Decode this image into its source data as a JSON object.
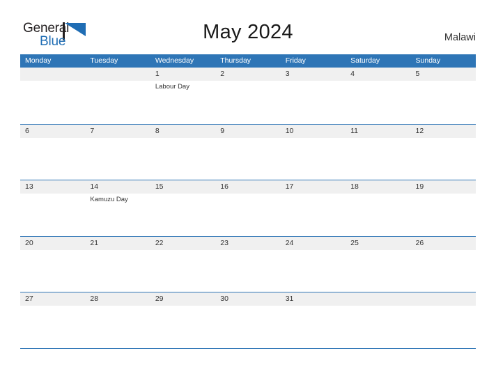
{
  "brand": {
    "name_part1": "General",
    "name_part2": "Blue",
    "mark_icon": "general-blue-triangle-logo",
    "accent_color": "#1f6db4"
  },
  "header": {
    "title": "May 2024",
    "country": "Malawi"
  },
  "calendar": {
    "header_bg_color": "#2e75b6",
    "band_bg_color": "#f0f0f0",
    "day_names": [
      "Monday",
      "Tuesday",
      "Wednesday",
      "Thursday",
      "Friday",
      "Saturday",
      "Sunday"
    ],
    "weeks": [
      [
        {
          "day": "",
          "event": ""
        },
        {
          "day": "",
          "event": ""
        },
        {
          "day": "1",
          "event": "Labour Day"
        },
        {
          "day": "2",
          "event": ""
        },
        {
          "day": "3",
          "event": ""
        },
        {
          "day": "4",
          "event": ""
        },
        {
          "day": "5",
          "event": ""
        }
      ],
      [
        {
          "day": "6",
          "event": ""
        },
        {
          "day": "7",
          "event": ""
        },
        {
          "day": "8",
          "event": ""
        },
        {
          "day": "9",
          "event": ""
        },
        {
          "day": "10",
          "event": ""
        },
        {
          "day": "11",
          "event": ""
        },
        {
          "day": "12",
          "event": ""
        }
      ],
      [
        {
          "day": "13",
          "event": ""
        },
        {
          "day": "14",
          "event": "Kamuzu Day"
        },
        {
          "day": "15",
          "event": ""
        },
        {
          "day": "16",
          "event": ""
        },
        {
          "day": "17",
          "event": ""
        },
        {
          "day": "18",
          "event": ""
        },
        {
          "day": "19",
          "event": ""
        }
      ],
      [
        {
          "day": "20",
          "event": ""
        },
        {
          "day": "21",
          "event": ""
        },
        {
          "day": "22",
          "event": ""
        },
        {
          "day": "23",
          "event": ""
        },
        {
          "day": "24",
          "event": ""
        },
        {
          "day": "25",
          "event": ""
        },
        {
          "day": "26",
          "event": ""
        }
      ],
      [
        {
          "day": "27",
          "event": ""
        },
        {
          "day": "28",
          "event": ""
        },
        {
          "day": "29",
          "event": ""
        },
        {
          "day": "30",
          "event": ""
        },
        {
          "day": "31",
          "event": ""
        },
        {
          "day": "",
          "event": ""
        },
        {
          "day": "",
          "event": ""
        }
      ]
    ]
  }
}
